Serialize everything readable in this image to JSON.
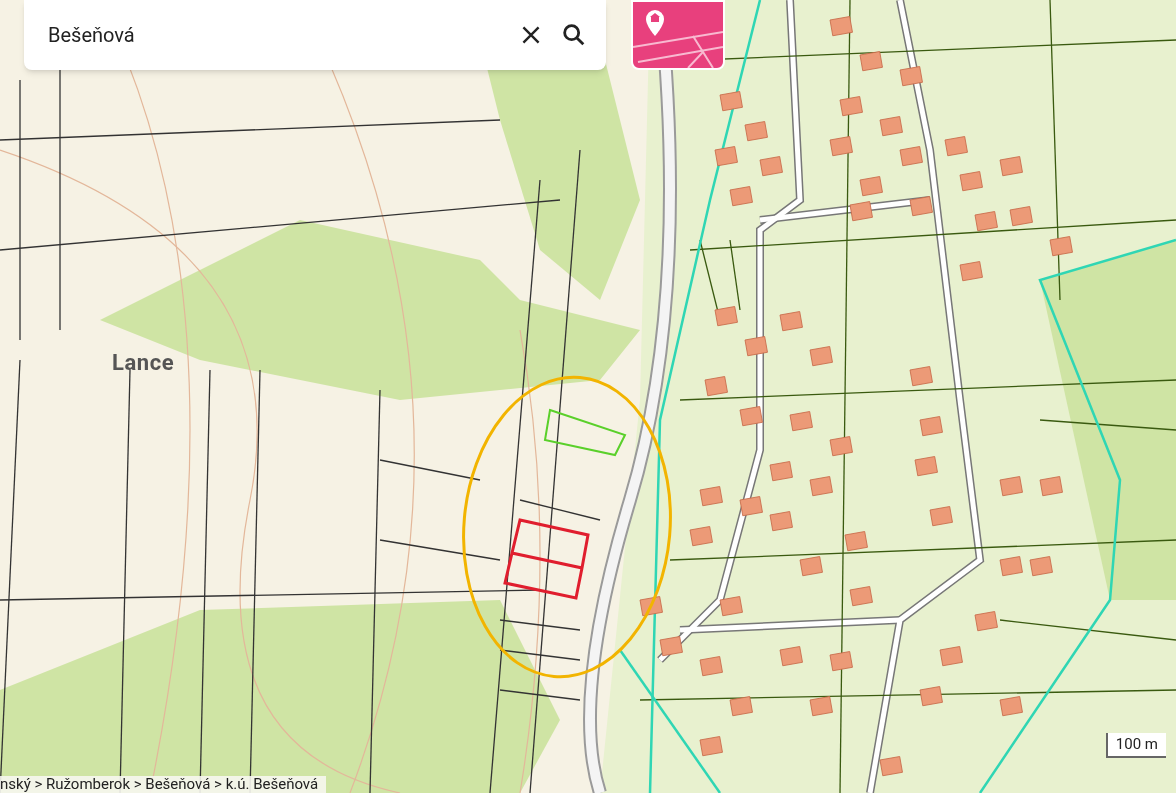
{
  "search": {
    "value": "Bešeňová"
  },
  "map": {
    "place_label": "Lance",
    "scale": "100 m"
  },
  "breadcrumb": "nský > Ružomberok > Bešeňová > k.ú. Bešeňová"
}
